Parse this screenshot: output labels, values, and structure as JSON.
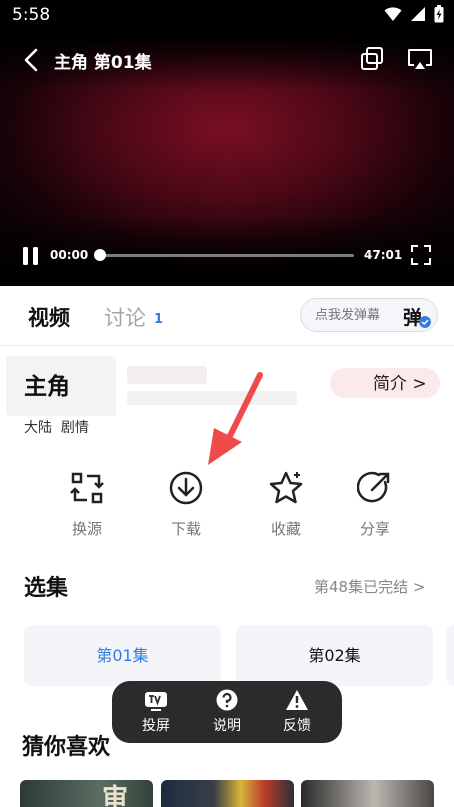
{
  "status_bar": {
    "time": "5:58"
  },
  "player": {
    "title": "主角 第01集",
    "current_time": "00:00",
    "total_time": "47:01",
    "progress": 0
  },
  "tabs": {
    "video": "视频",
    "discuss": "讨论",
    "discuss_count": "1",
    "danmu_placeholder": "点我发弹幕",
    "danmu_icon_text": "弹"
  },
  "show": {
    "title": "主角",
    "intro_link": "简介 >",
    "tags": "大陆  剧情"
  },
  "actions": [
    {
      "label": "换源",
      "icon": "switch-source-icon"
    },
    {
      "label": "下载",
      "icon": "download-icon"
    },
    {
      "label": "收藏",
      "icon": "star-icon"
    },
    {
      "label": "分享",
      "icon": "share-icon"
    }
  ],
  "episodes": {
    "title": "选集",
    "status": "第48集已完结 >",
    "items": [
      "第01集",
      "第02集"
    ]
  },
  "float_toolbar": [
    {
      "label": "投屏",
      "icon": "tv-icon"
    },
    {
      "label": "说明",
      "icon": "help-icon"
    },
    {
      "label": "反馈",
      "icon": "warning-icon"
    }
  ],
  "recommend": {
    "title": "猜你喜欢",
    "poster_text": "审"
  },
  "colors": {
    "accent": "#2f7de1",
    "arrow": "#ef4a4a",
    "toolbar": "#2b2b2b"
  }
}
